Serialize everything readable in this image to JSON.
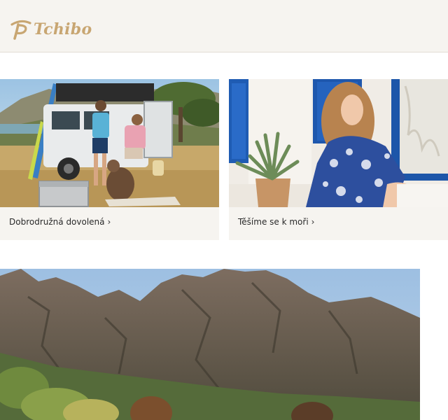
{
  "header": {
    "logo_text": "Tchibo",
    "brand_color": "#c8a672"
  },
  "cards": [
    {
      "label": "Dobrodružná dovolená",
      "chevron": "›",
      "icon": "chevron-right-icon"
    },
    {
      "label": "Těšíme se k moři",
      "chevron": "›",
      "icon": "chevron-right-icon"
    }
  ],
  "colors": {
    "header_bg": "#f6f4f0",
    "card_bg": "#f6f4f0",
    "text": "#2a2a2a"
  }
}
